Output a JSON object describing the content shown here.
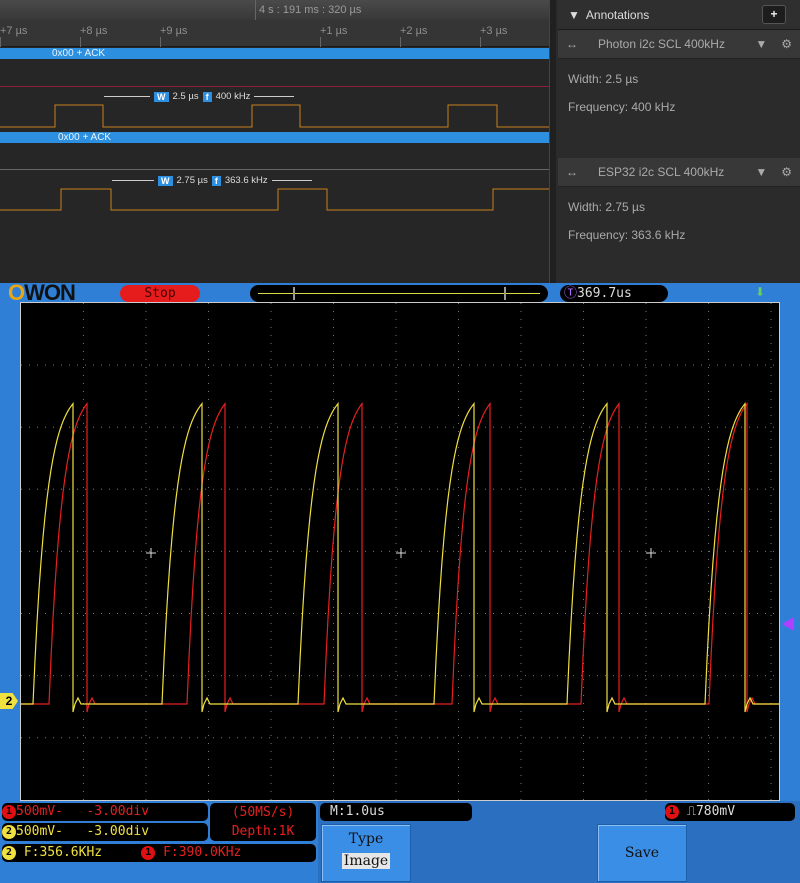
{
  "logic_analyzer": {
    "timestamp": "4 s : 191 ms : 320 µs",
    "ticks": [
      "+7 µs",
      "+8 µs",
      "+9 µs",
      "+1 µs",
      "+2 µs",
      "+3 µs"
    ],
    "channels": [
      {
        "decode": "0x00 + ACK",
        "width_badge": "W",
        "width": "2.5 µs",
        "freq_badge": "f",
        "freq": "400 kHz"
      },
      {
        "decode": "0x00 + ACK",
        "width_badge": "W",
        "width": "2.75 µs",
        "freq_badge": "f",
        "freq": "363.6 kHz"
      }
    ],
    "panel": {
      "title": "Annotations",
      "add_label": "+",
      "annotations": [
        {
          "name": "Photon i2c SCL 400kHz",
          "width": "Width: 2.5 µs",
          "frequency": "Frequency: 400 kHz"
        },
        {
          "name": "ESP32 i2c SCL 400kHz",
          "width": "Width: 2.75 µs",
          "frequency": "Frequency: 363.6 kHz"
        }
      ]
    },
    "colors": {
      "decode": "#2d8fe0",
      "clock": "#c8801e"
    }
  },
  "scope": {
    "brand": "OWON",
    "state": "Stop",
    "trigger_time": "369.7us",
    "ch1": {
      "num": "1",
      "scale": "500mV-",
      "offset": "-3.00div",
      "freq": "F:390.0KHz",
      "color": "#e62020"
    },
    "ch2": {
      "num": "2",
      "scale": "500mV-",
      "offset": "-3.00div",
      "freq": "F:356.6KHz",
      "color": "#f0e040"
    },
    "sample_rate": "(50MS/s)",
    "depth": "Depth:1K",
    "timebase": "M:1.0us",
    "trigger": {
      "source": "1",
      "level": "780mV"
    },
    "menu": {
      "type_label": "Type",
      "type_value": "Image",
      "save_label": "Save"
    },
    "ch2_marker": "2"
  }
}
